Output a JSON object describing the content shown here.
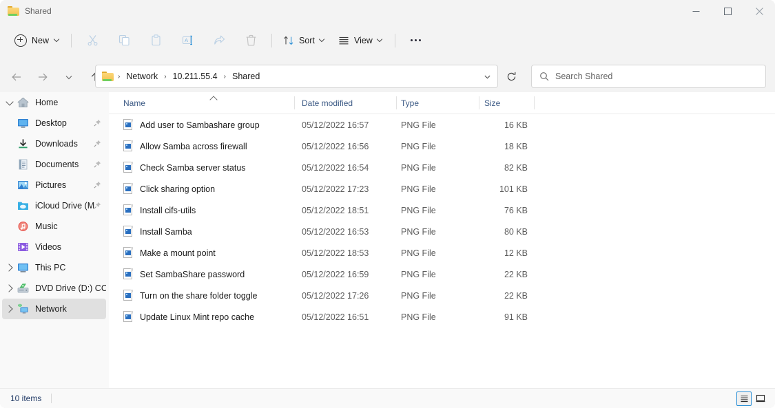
{
  "window": {
    "title": "Shared",
    "folder_icon": "folder-icon",
    "minimize_label": "Minimize",
    "maximize_label": "Maximize",
    "close_label": "Close"
  },
  "toolbar": {
    "new_label": "New",
    "sort_label": "Sort",
    "view_label": "View",
    "items": [
      {
        "name": "cut-icon",
        "tooltip": "Cut"
      },
      {
        "name": "copy-icon",
        "tooltip": "Copy"
      },
      {
        "name": "paste-icon",
        "tooltip": "Paste"
      },
      {
        "name": "rename-icon",
        "tooltip": "Rename"
      },
      {
        "name": "share-icon",
        "tooltip": "Share"
      },
      {
        "name": "delete-icon",
        "tooltip": "Delete"
      }
    ],
    "more_label": "See more"
  },
  "address": {
    "back_label": "Back",
    "forward_label": "Forward",
    "recent_label": "Recent locations",
    "up_label": "Up to Network",
    "crumbs": [
      "Network",
      "10.211.55.4",
      "Shared"
    ],
    "separator": "›",
    "dropdown_label": "Previous locations",
    "refresh_label": "Refresh"
  },
  "search": {
    "placeholder": "Search Shared",
    "icon": "search-icon"
  },
  "sidebar": {
    "items": [
      {
        "label": "Home",
        "icon": "home-icon",
        "twisty": "expanded",
        "indent": false,
        "pinned": false,
        "selected": false
      },
      {
        "label": "Desktop",
        "icon": "desktop-icon",
        "twisty": "none",
        "indent": true,
        "pinned": true,
        "selected": false
      },
      {
        "label": "Downloads",
        "icon": "downloads-icon",
        "twisty": "none",
        "indent": true,
        "pinned": true,
        "selected": false
      },
      {
        "label": "Documents",
        "icon": "documents-icon",
        "twisty": "none",
        "indent": true,
        "pinned": true,
        "selected": false
      },
      {
        "label": "Pictures",
        "icon": "pictures-icon",
        "twisty": "none",
        "indent": true,
        "pinned": true,
        "selected": false
      },
      {
        "label": "iCloud Drive (M",
        "icon": "icloud-icon",
        "twisty": "none",
        "indent": true,
        "pinned": true,
        "selected": false
      },
      {
        "label": "Music",
        "icon": "music-icon",
        "twisty": "none",
        "indent": true,
        "pinned": false,
        "selected": false
      },
      {
        "label": "Videos",
        "icon": "videos-icon",
        "twisty": "none",
        "indent": true,
        "pinned": false,
        "selected": false
      },
      {
        "label": "This PC",
        "icon": "this-pc-icon",
        "twisty": "collapsed",
        "indent": false,
        "pinned": false,
        "selected": false
      },
      {
        "label": "DVD Drive (D:) CCCO",
        "icon": "dvd-drive-icon",
        "twisty": "collapsed",
        "indent": false,
        "pinned": false,
        "selected": false
      },
      {
        "label": "Network",
        "icon": "network-icon",
        "twisty": "collapsed",
        "indent": false,
        "pinned": false,
        "selected": true
      }
    ]
  },
  "filelist": {
    "columns": [
      "Name",
      "Date modified",
      "Type",
      "Size"
    ],
    "sort_column": "Name",
    "sort_direction": "ascending",
    "rows": [
      {
        "name": "Add user to Sambashare group",
        "date": "05/12/2022 16:57",
        "type": "PNG File",
        "size": "16 KB",
        "icon": "png-file-icon"
      },
      {
        "name": "Allow Samba across firewall",
        "date": "05/12/2022 16:56",
        "type": "PNG File",
        "size": "18 KB",
        "icon": "png-file-icon"
      },
      {
        "name": "Check Samba server status",
        "date": "05/12/2022 16:54",
        "type": "PNG File",
        "size": "82 KB",
        "icon": "png-file-icon"
      },
      {
        "name": "Click sharing option",
        "date": "05/12/2022 17:23",
        "type": "PNG File",
        "size": "101 KB",
        "icon": "png-file-icon"
      },
      {
        "name": "Install cifs-utils",
        "date": "05/12/2022 18:51",
        "type": "PNG File",
        "size": "76 KB",
        "icon": "png-file-icon"
      },
      {
        "name": "Install Samba",
        "date": "05/12/2022 16:53",
        "type": "PNG File",
        "size": "80 KB",
        "icon": "png-file-icon"
      },
      {
        "name": "Make a mount point",
        "date": "05/12/2022 18:53",
        "type": "PNG File",
        "size": "12 KB",
        "icon": "png-file-icon"
      },
      {
        "name": "Set SambaShare password",
        "date": "05/12/2022 16:59",
        "type": "PNG File",
        "size": "22 KB",
        "icon": "png-file-icon"
      },
      {
        "name": "Turn on the share folder toggle",
        "date": "05/12/2022 17:26",
        "type": "PNG File",
        "size": "22 KB",
        "icon": "png-file-icon"
      },
      {
        "name": "Update Linux Mint repo cache",
        "date": "05/12/2022 16:51",
        "type": "PNG File",
        "size": "91 KB",
        "icon": "png-file-icon"
      }
    ]
  },
  "statusbar": {
    "item_count": "10 items",
    "details_view_label": "Details view",
    "large_icons_view_label": "Large icons view",
    "active_view": "details"
  },
  "colors": {
    "accent": "#2a8fd6",
    "window_bg": "#f3f3f3",
    "content_bg": "#ffffff",
    "sidebar_bg": "#f9f9f9",
    "selection": "#e0e0e0",
    "column_header_text": "#3c5a85",
    "status_text": "#1f3864"
  }
}
